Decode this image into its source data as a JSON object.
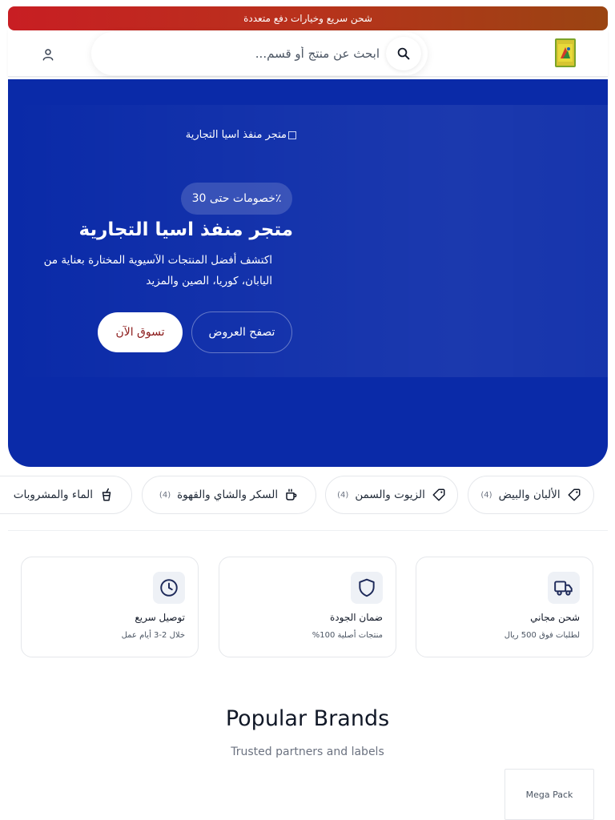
{
  "promo_bar": {
    "text": "شحن سريع وخيارات دفع متعددة"
  },
  "header": {
    "search": {
      "placeholder": "ابحث عن منتج أو قسم..."
    }
  },
  "hero": {
    "image_alt": "متجر منفذ اسيا التجارية",
    "badge": "٪خصومات حتى 30",
    "title": "متجر منفذ اسيا التجارية",
    "subtitle": "اكتشف أفضل المنتجات الآسيوية المختارة بعناية من اليابان، كوريا، الصين والمزيد",
    "btn_offers": "تصفح العروض",
    "btn_shop": "تسوق الآن"
  },
  "categories": [
    {
      "label": "الألبان والبيض",
      "count": "(4)",
      "icon": "tag-icon"
    },
    {
      "label": "الزيوت والسمن",
      "count": "(4)",
      "icon": "tag-icon"
    },
    {
      "label": "السكر والشاي والقهوة",
      "count": "(4)",
      "icon": "coffee-cup-icon"
    },
    {
      "label": "الماء والمشروبات",
      "count": "",
      "icon": "drink-cup-icon"
    }
  ],
  "features": [
    {
      "title": "شحن مجاني",
      "subtitle": "لطلبات فوق 500 ريال",
      "icon": "truck-icon"
    },
    {
      "title": "ضمان الجودة",
      "subtitle": "منتجات أصلية 100%",
      "icon": "shield-icon"
    },
    {
      "title": "توصيل سريع",
      "subtitle": "خلال 2-3 أيام عمل",
      "icon": "clock-icon"
    }
  ],
  "brands": {
    "title": "Popular Brands",
    "subtitle": "Trusted partners and labels",
    "items": [
      {
        "name": "Mega Pack"
      }
    ]
  },
  "colors": {
    "primary_blue": "#0a2aa8",
    "promo_red": "#c81e23",
    "icon_navy": "#1e2a5a"
  }
}
